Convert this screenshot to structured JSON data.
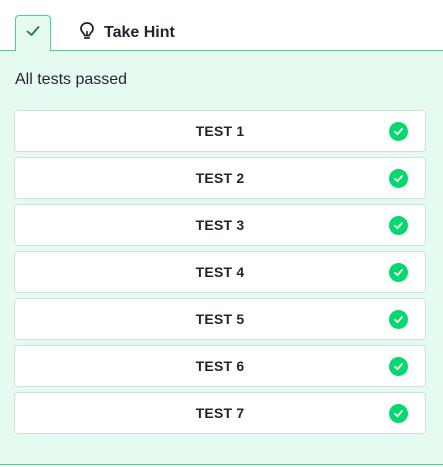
{
  "tabs": {
    "result_tab_icon": "check-icon",
    "hint_icon": "lightbulb-icon",
    "hint_label": "Take Hint"
  },
  "status_text": "All tests passed",
  "tests": [
    {
      "label": "TEST 1",
      "status": "passed"
    },
    {
      "label": "TEST 2",
      "status": "passed"
    },
    {
      "label": "TEST 3",
      "status": "passed"
    },
    {
      "label": "TEST 4",
      "status": "passed"
    },
    {
      "label": "TEST 5",
      "status": "passed"
    },
    {
      "label": "TEST 6",
      "status": "passed"
    },
    {
      "label": "TEST 7",
      "status": "passed"
    }
  ],
  "colors": {
    "accent": "#4cd388",
    "success": "#05d86e",
    "panel_bg": "#e6fbef",
    "text": "#1f2430"
  }
}
